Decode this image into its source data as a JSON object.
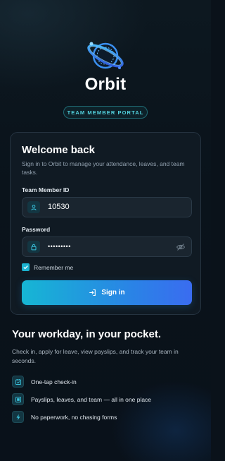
{
  "brand": {
    "name": "Orbit",
    "portal_badge": "TEAM MEMBER PORTAL"
  },
  "login": {
    "title": "Welcome back",
    "subtitle": "Sign in to Orbit to manage your attendance, leaves, and team tasks.",
    "member_id_label": "Team Member ID",
    "member_id_value": "10530",
    "password_label": "Password",
    "password_value": "•••••••••",
    "remember_label": "Remember me",
    "remember_checked": true,
    "signin_label": "Sign in"
  },
  "pitch": {
    "title": "Your workday, in your pocket.",
    "subtitle": "Check in, apply for leave, view payslips, and track your team in seconds.",
    "features": [
      {
        "icon": "calendar-check-icon",
        "label": "One-tap check-in"
      },
      {
        "icon": "payslip-icon",
        "label": "Payslips, leaves, and team — all in one place"
      },
      {
        "icon": "lightning-icon",
        "label": "No paperwork, no chasing forms"
      }
    ]
  },
  "colors": {
    "background": "#0a121a",
    "accent": "#1bb2cf",
    "button_start": "#16b6d4",
    "button_end": "#3a6cf0"
  }
}
